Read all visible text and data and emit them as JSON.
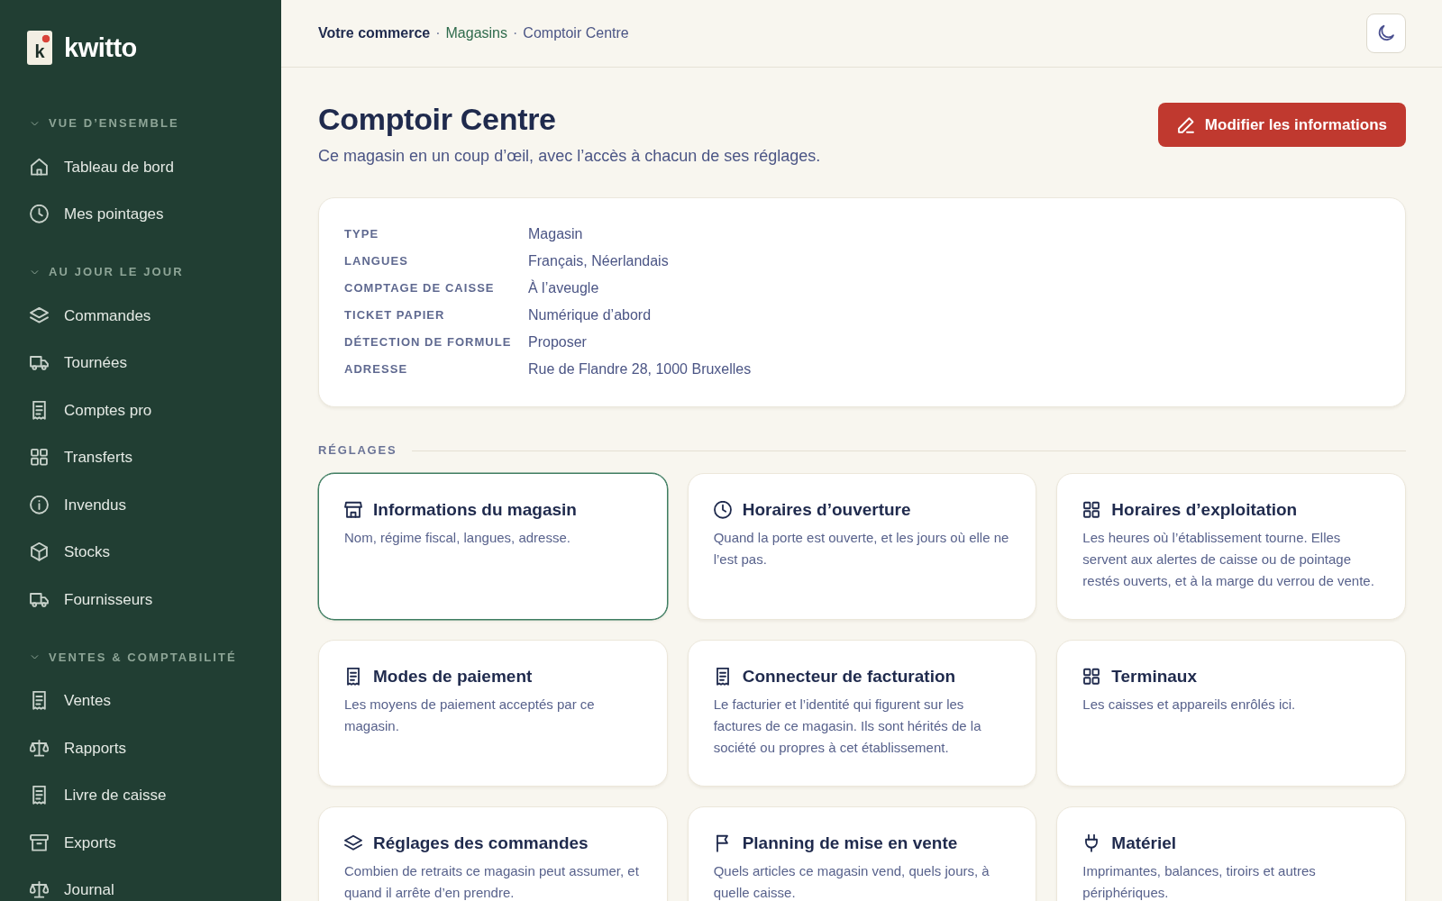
{
  "sidebar": {
    "logo": {
      "mark": "k",
      "name": "kwitto"
    },
    "sections": [
      {
        "title": "VUE D’ENSEMBLE",
        "expanded": true,
        "items": [
          {
            "label": "Tableau de bord",
            "selected": false
          },
          {
            "label": "Mes pointages",
            "selected": false
          }
        ]
      },
      {
        "title": "AU JOUR LE JOUR",
        "expanded": true,
        "items": [
          {
            "label": "Commandes",
            "selected": false
          },
          {
            "label": "Tournées",
            "selected": false
          },
          {
            "label": "Comptes pro",
            "selected": false
          },
          {
            "label": "Transferts",
            "selected": false
          },
          {
            "label": "Invendus",
            "selected": false
          },
          {
            "label": "Stocks",
            "selected": false
          },
          {
            "label": "Fournisseurs",
            "selected": false
          }
        ]
      },
      {
        "title": "VENTES & COMPTABILITÉ",
        "expanded": true,
        "items": [
          {
            "label": "Ventes",
            "selected": false
          },
          {
            "label": "Rapports",
            "selected": false
          },
          {
            "label": "Livre de caisse",
            "selected": false
          },
          {
            "label": "Exports",
            "selected": false
          },
          {
            "label": "Journal",
            "selected": false
          }
        ]
      }
    ]
  },
  "header": {
    "breadcrumb": [
      {
        "label": "Votre commerce",
        "kind": "root"
      },
      {
        "label": "·",
        "kind": "separator"
      },
      {
        "label": "Magasins",
        "kind": "link"
      },
      {
        "label": "·",
        "kind": "separator"
      },
      {
        "label": "Comptoir Centre",
        "kind": "current"
      }
    ]
  },
  "page": {
    "title": "Comptoir Centre",
    "subtitle": "Ce magasin en un coup d’œil, avec l’accès à chacun de ses réglages.",
    "action": "Modifier les informations"
  },
  "details": [
    {
      "label": "TYPE",
      "value": "Magasin"
    },
    {
      "label": "LANGUES",
      "value": "Français, Néerlandais"
    },
    {
      "label": "COMPTAGE DE CAISSE",
      "value": "À l’aveugle"
    },
    {
      "label": "TICKET PAPIER",
      "value": "Numérique d’abord"
    },
    {
      "label": "DÉTECTION DE FORMULE",
      "value": "Proposer"
    },
    {
      "label": "ADRESSE",
      "value": "Rue de Flandre 28, 1000 Bruxelles"
    }
  ],
  "settings": {
    "title": "RÉGLAGES",
    "cards": [
      {
        "title": "Informations du magasin",
        "description": "Nom, régime fiscal, langues, adresse.",
        "selected": true
      },
      {
        "title": "Horaires d’ouverture",
        "description": "Quand la porte est ouverte, et les jours où elle ne l’est pas.",
        "selected": false
      },
      {
        "title": "Horaires d’exploitation",
        "description": "Les heures où l’établissement tourne. Elles servent aux alertes de caisse ou de pointage restés ouverts, et à la marge du verrou de vente.",
        "selected": false
      },
      {
        "title": "Modes de paiement",
        "description": "Les moyens de paiement acceptés par ce magasin.",
        "selected": false
      },
      {
        "title": "Connecteur de facturation",
        "description": "Le facturier et l’identité qui figurent sur les factures de ce magasin. Ils sont hérités de la société ou propres à cet établissement.",
        "selected": false
      },
      {
        "title": "Terminaux",
        "description": "Les caisses et appareils enrôlés ici.",
        "selected": false
      },
      {
        "title": "Réglages des commandes",
        "description": "Combien de retraits ce magasin peut assumer, et quand il arrête d’en prendre.",
        "selected": false
      },
      {
        "title": "Planning de mise en vente",
        "description": "Quels articles ce magasin vend, quels jours, à quelle caisse.",
        "selected": false
      },
      {
        "title": "Matériel",
        "description": "Imprimantes, balances, tiroirs et autres périphériques.",
        "selected": false
      }
    ]
  }
}
